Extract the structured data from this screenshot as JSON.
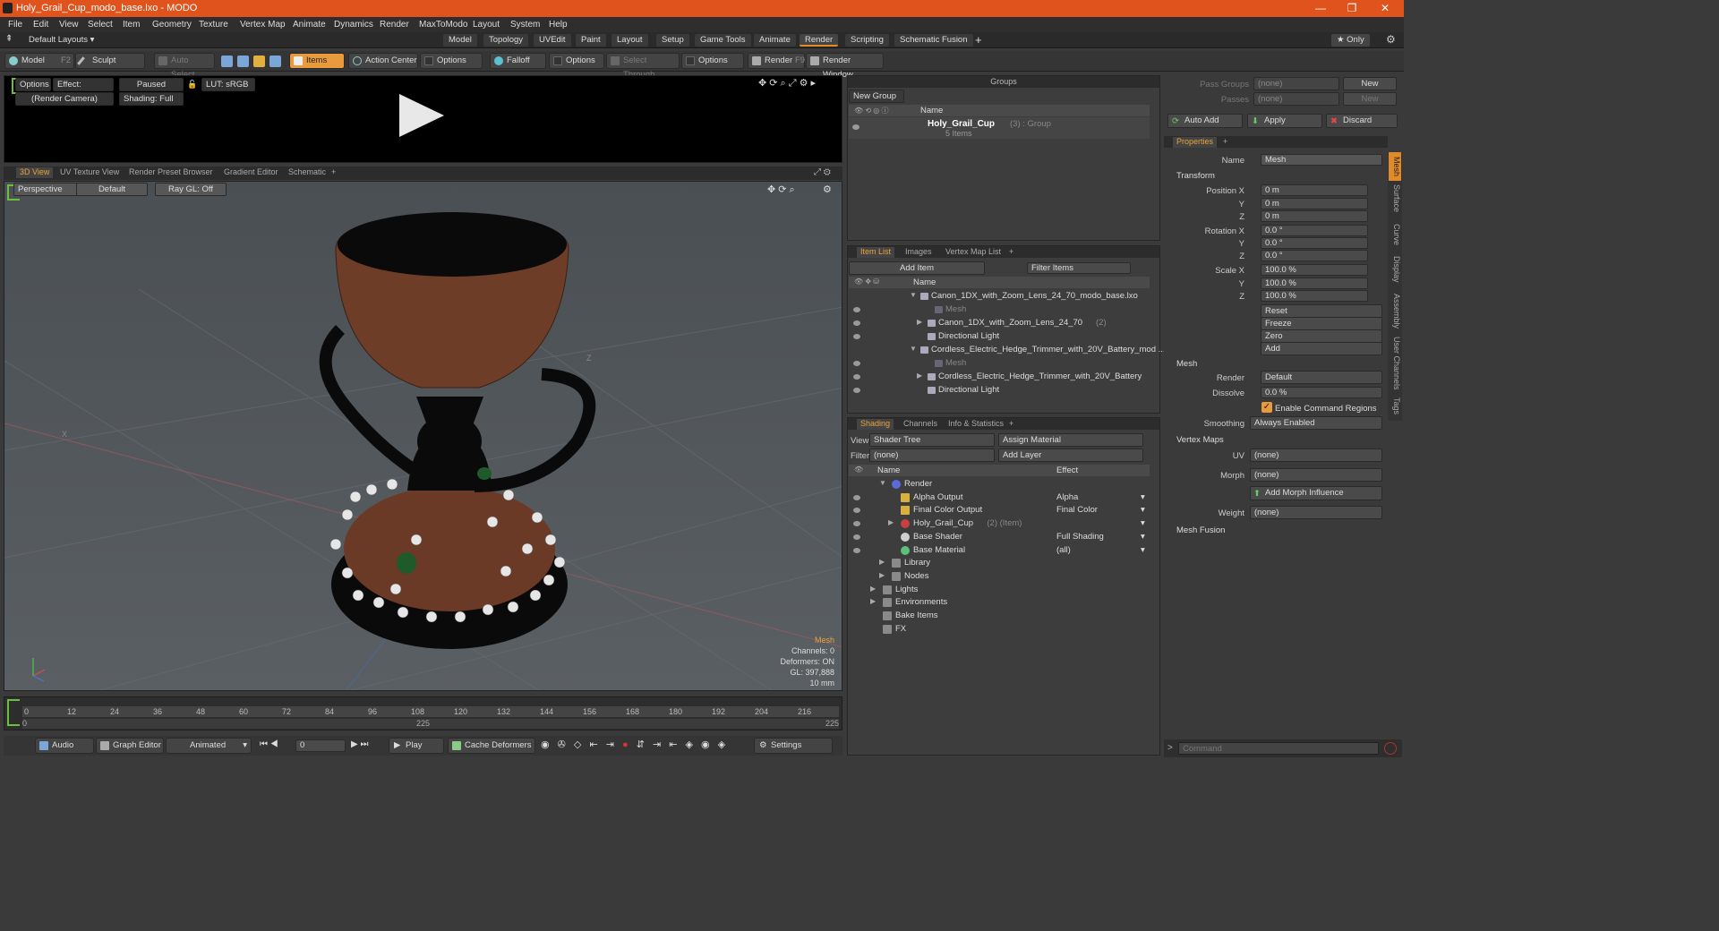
{
  "window": {
    "title": "Holy_Grail_Cup_modo_base.lxo - MODO",
    "controls": [
      "—",
      "❐",
      "✕"
    ]
  },
  "menu": [
    "File",
    "Edit",
    "View",
    "Select",
    "Item",
    "Geometry",
    "Texture",
    "Vertex Map",
    "Animate",
    "Dynamics",
    "Render",
    "MaxToModo",
    "Layout",
    "System",
    "Help"
  ],
  "layoutbar": {
    "layouts_label": "Default Layouts ▾",
    "tabs": [
      "Model",
      "Topology",
      "UVEdit",
      "Paint",
      "Layout",
      "Setup",
      "Game Tools",
      "Animate",
      "Render",
      "Scripting",
      "Schematic Fusion"
    ],
    "active_tab": "Render",
    "plus": "+",
    "only": "★ Only",
    "gear": "⚙"
  },
  "toolbar": {
    "model": "Model",
    "model_key": "F2",
    "sculpt": "Sculpt",
    "auto_select": "Auto Select",
    "items": "Items",
    "action_center": "Action Center",
    "options1": "Options",
    "falloff": "Falloff",
    "options2": "Options",
    "select_through": "Select Through",
    "options3": "Options",
    "render": "Render",
    "render_key": "F9",
    "render_window": "Render Window"
  },
  "preview": {
    "options": "Options",
    "effect": "Effect: (Shadi...",
    "paused": "Paused",
    "lut": "LUT: sRGB",
    "camera": "(Render Camera)",
    "shading": "Shading: Full"
  },
  "viewport_tabs": [
    "3D View",
    "UV Texture View",
    "Render Preset Browser",
    "Gradient Editor",
    "Schematic",
    "+"
  ],
  "viewport": {
    "perspective": "Perspective",
    "default": "Default",
    "raygl": "Ray GL: Off",
    "axis_z": "Z",
    "axis_x": "X",
    "info": {
      "title": "Mesh",
      "channels": "Channels: 0",
      "deformers": "Deformers: ON",
      "gl": "GL: 397,888",
      "size": "10 mm"
    }
  },
  "timeline": {
    "ticks": [
      "0",
      "12",
      "24",
      "36",
      "48",
      "60",
      "72",
      "84",
      "96",
      "108",
      "120",
      "132",
      "144",
      "156",
      "168",
      "180",
      "192",
      "204",
      "216"
    ],
    "start": "0",
    "mid": "225",
    "end": "225"
  },
  "bottombar": {
    "audio": "Audio",
    "graph_editor": "Graph Editor",
    "animated": "Animated",
    "frame": "0",
    "play": "Play",
    "cache_deformers": "Cache Deformers",
    "settings": "Settings"
  },
  "groups": {
    "title": "Groups",
    "new_group": "New Group",
    "col_name": "Name",
    "item_name": "Holy_Grail_Cup",
    "item_meta": "(3) : Group",
    "item_sub": "5 Items"
  },
  "itemlist": {
    "tabs": [
      "Item List",
      "Images",
      "Vertex Map List",
      "+"
    ],
    "add_item": "Add Item",
    "filter": "Filter Items",
    "col_name": "Name",
    "rows": [
      {
        "label": "Canon_1DX_with_Zoom_Lens_24_70_modo_base.lxo",
        "indent": 0,
        "dim": false
      },
      {
        "label": "Mesh",
        "indent": 2,
        "dim": true
      },
      {
        "label": "Canon_1DX_with_Zoom_Lens_24_70",
        "extra": "(2)",
        "indent": 1,
        "dim": false
      },
      {
        "label": "Directional Light",
        "indent": 1,
        "dim": false
      },
      {
        "label": "Cordless_Electric_Hedge_Trimmer_with_20V_Battery_mod ...",
        "indent": 0,
        "dim": false
      },
      {
        "label": "Mesh",
        "indent": 2,
        "dim": true
      },
      {
        "label": "Cordless_Electric_Hedge_Trimmer_with_20V_Battery",
        "extra": "(2)",
        "indent": 1,
        "dim": false
      },
      {
        "label": "Directional Light",
        "indent": 1,
        "dim": false
      }
    ]
  },
  "shading": {
    "tabs": [
      "Shading",
      "Channels",
      "Info & Statistics",
      "+"
    ],
    "view_label": "View",
    "view_value": "Shader Tree",
    "assign_material": "Assign Material",
    "filter_label": "Filter",
    "filter_value": "(none)",
    "add_layer": "Add Layer",
    "col_name": "Name",
    "col_effect": "Effect",
    "rows": [
      {
        "label": "Render",
        "effect": "",
        "indent": 1
      },
      {
        "label": "Alpha Output",
        "effect": "Alpha",
        "indent": 2
      },
      {
        "label": "Final Color Output",
        "effect": "Final Color",
        "indent": 2
      },
      {
        "label": "Holy_Grail_Cup",
        "extra": "(2) (Item)",
        "effect": "",
        "indent": 2
      },
      {
        "label": "Base Shader",
        "effect": "Full Shading",
        "indent": 2
      },
      {
        "label": "Base Material",
        "effect": "(all)",
        "indent": 2
      },
      {
        "label": "Library",
        "effect": "",
        "indent": 1
      },
      {
        "label": "Nodes",
        "effect": "",
        "indent": 1
      },
      {
        "label": "Lights",
        "effect": "",
        "indent": 0
      },
      {
        "label": "Environments",
        "effect": "",
        "indent": 0
      },
      {
        "label": "Bake Items",
        "effect": "",
        "indent": 0
      },
      {
        "label": "FX",
        "effect": "",
        "indent": 0
      }
    ]
  },
  "passes": {
    "pass_groups": "Pass Groups",
    "passes": "Passes",
    "none1": "(none)",
    "none2": "(none)",
    "new1": "New",
    "new2": "New",
    "auto_add": "Auto Add",
    "apply": "Apply",
    "discard": "Discard"
  },
  "properties": {
    "tab": "Properties",
    "plus": "+",
    "name_label": "Name",
    "name_value": "Mesh",
    "transform": "Transform",
    "position": [
      "0 m",
      "0 m",
      "0 m"
    ],
    "rotation": [
      "0.0 °",
      "0.0 °",
      "0.0 °"
    ],
    "scale": [
      "100.0 %",
      "100.0 %",
      "100.0 %"
    ],
    "labels": {
      "px": "Position X",
      "y": "Y",
      "z": "Z",
      "rx": "Rotation X",
      "sx": "Scale X"
    },
    "actions": [
      "Reset",
      "Freeze",
      "Zero",
      "Add"
    ],
    "mesh": "Mesh",
    "render_label": "Render",
    "render_value": "Default",
    "dissolve_label": "Dissolve",
    "dissolve_value": "0.0 %",
    "enable_cmd": "Enable Command Regions",
    "smoothing_label": "Smoothing",
    "smoothing_value": "Always Enabled",
    "vertex_maps": "Vertex Maps",
    "uv_label": "UV",
    "uv_value": "(none)",
    "morph_label": "Morph",
    "morph_value": "(none)",
    "add_morph": "Add Morph Influence",
    "weight_label": "Weight",
    "weight_value": "(none)",
    "mesh_fusion": "Mesh Fusion",
    "side_tabs": [
      "Mesh",
      "Surface",
      "Curve",
      "Display",
      "Assembly",
      "User Channels",
      "Tags"
    ]
  },
  "command": {
    "placeholder": "Command",
    "prompt": ">"
  },
  "colors": {
    "accent": "#e08a2a",
    "titlebar": "#e0531c"
  }
}
